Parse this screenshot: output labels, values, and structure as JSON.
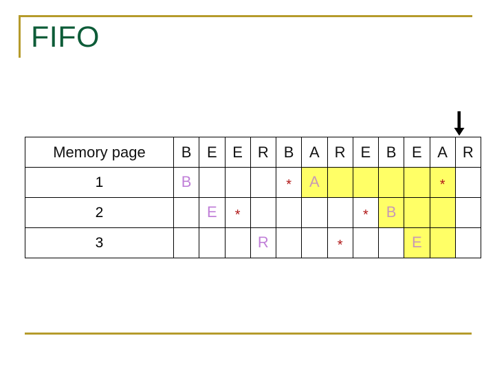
{
  "slide": {
    "title": "FIFO",
    "accent_color": "#b59b2b",
    "title_color": "#0d5c38",
    "highlight_color": "#ffff66",
    "letter_color": "#c07fd8",
    "star_color": "#b01818"
  },
  "arrow": {
    "icon": "arrow-down-icon",
    "points_to_column_index": 12
  },
  "table": {
    "row_header_label": "Memory page",
    "reference_string": [
      "B",
      "E",
      "E",
      "R",
      "B",
      "A",
      "R",
      "E",
      "B",
      "E",
      "A",
      "R"
    ],
    "rows": [
      {
        "label": "1",
        "cells": [
          {
            "text": "B",
            "kind": "letter",
            "highlight": false
          },
          {
            "text": "",
            "kind": "empty",
            "highlight": false
          },
          {
            "text": "",
            "kind": "empty",
            "highlight": false
          },
          {
            "text": "",
            "kind": "empty",
            "highlight": false
          },
          {
            "text": "*",
            "kind": "star",
            "highlight": false
          },
          {
            "text": "A",
            "kind": "letter",
            "highlight": true
          },
          {
            "text": "",
            "kind": "empty",
            "highlight": true
          },
          {
            "text": "",
            "kind": "empty",
            "highlight": true
          },
          {
            "text": "",
            "kind": "empty",
            "highlight": true
          },
          {
            "text": "",
            "kind": "empty",
            "highlight": true
          },
          {
            "text": "*",
            "kind": "star",
            "highlight": true
          },
          {
            "text": "",
            "kind": "empty",
            "highlight": false
          }
        ]
      },
      {
        "label": "2",
        "cells": [
          {
            "text": "",
            "kind": "empty",
            "highlight": false
          },
          {
            "text": "E",
            "kind": "letter",
            "highlight": false
          },
          {
            "text": "*",
            "kind": "star",
            "highlight": false
          },
          {
            "text": "",
            "kind": "empty",
            "highlight": false
          },
          {
            "text": "",
            "kind": "empty",
            "highlight": false
          },
          {
            "text": "",
            "kind": "empty",
            "highlight": false
          },
          {
            "text": "",
            "kind": "empty",
            "highlight": false
          },
          {
            "text": "*",
            "kind": "star",
            "highlight": false
          },
          {
            "text": "B",
            "kind": "letter",
            "highlight": true
          },
          {
            "text": "",
            "kind": "empty",
            "highlight": true
          },
          {
            "text": "",
            "kind": "empty",
            "highlight": true
          },
          {
            "text": "",
            "kind": "empty",
            "highlight": false
          }
        ]
      },
      {
        "label": "3",
        "cells": [
          {
            "text": "",
            "kind": "empty",
            "highlight": false
          },
          {
            "text": "",
            "kind": "empty",
            "highlight": false
          },
          {
            "text": "",
            "kind": "empty",
            "highlight": false
          },
          {
            "text": "R",
            "kind": "letter",
            "highlight": false
          },
          {
            "text": "",
            "kind": "empty",
            "highlight": false
          },
          {
            "text": "",
            "kind": "empty",
            "highlight": false
          },
          {
            "text": "*",
            "kind": "star",
            "highlight": false
          },
          {
            "text": "",
            "kind": "empty",
            "highlight": false
          },
          {
            "text": "",
            "kind": "empty",
            "highlight": false
          },
          {
            "text": "E",
            "kind": "letter",
            "highlight": true
          },
          {
            "text": "",
            "kind": "empty",
            "highlight": true
          },
          {
            "text": "",
            "kind": "empty",
            "highlight": false
          }
        ]
      }
    ]
  }
}
